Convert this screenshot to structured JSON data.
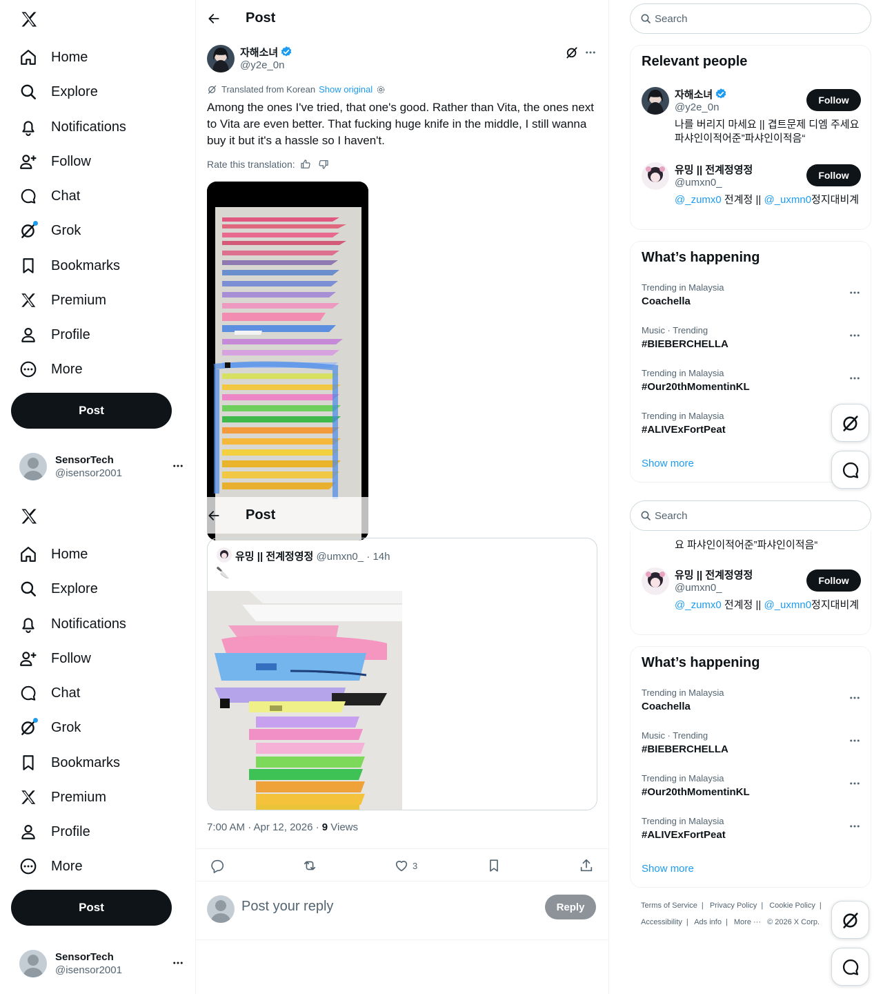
{
  "nav": {
    "items": [
      {
        "label": "Home",
        "icon": "home-icon"
      },
      {
        "label": "Explore",
        "icon": "search-icon"
      },
      {
        "label": "Notifications",
        "icon": "bell-icon"
      },
      {
        "label": "Follow",
        "icon": "person-add-icon"
      },
      {
        "label": "Chat",
        "icon": "chat-icon"
      },
      {
        "label": "Grok",
        "icon": "grok-icon"
      },
      {
        "label": "Bookmarks",
        "icon": "bookmark-icon"
      },
      {
        "label": "Premium",
        "icon": "x-logo-icon"
      },
      {
        "label": "Profile",
        "icon": "profile-icon"
      },
      {
        "label": "More",
        "icon": "more-circle-icon"
      }
    ],
    "post_label": "Post",
    "account": {
      "name": "SensorTech",
      "handle": "@isensor2001"
    }
  },
  "header": {
    "title": "Post"
  },
  "tweet": {
    "author_name": "자해소녀",
    "author_handle": "@y2e_0n",
    "translated_label": "Translated from Korean",
    "show_original": "Show original",
    "text": "Among the ones I've tried, that one's good. Rather than Vita, the ones next to Vita are even better. That fucking huge knife in the middle, I still wanna buy it but it's a hassle so I haven't.",
    "rate_label": "Rate this translation:",
    "quote": {
      "author_name": "유밍 || 전계정영정",
      "author_handle": "@umxn0_",
      "time": "· 14h",
      "text": "🔪"
    },
    "timestamp": "7:00 AM · Apr 12, 2026 · ",
    "views_count": "9",
    "views_label": " Views",
    "like_count": "3",
    "reply_placeholder": "Post your reply",
    "reply_button": "Reply"
  },
  "right": {
    "search_placeholder": "Search",
    "relevant_title": "Relevant people",
    "people": [
      {
        "name": "자해소녀",
        "handle": "@y2e_0n",
        "bio": "나를 버리지 마세요 || 겹트문제 디엠 주세요 파샤인이적어준”파샤인이적음“",
        "follow": "Follow"
      },
      {
        "name": "유밍 || 전계정영정",
        "handle": "@umxn0_",
        "bio_link1": "@_zumx0",
        "bio_mid": " 전계정 || ",
        "bio_link2": "@_uxmn0",
        "bio_end": "정지대비계",
        "follow": "Follow"
      }
    ],
    "happening_title": "What’s happening",
    "trends": [
      {
        "context": "Trending in Malaysia",
        "name": "Coachella"
      },
      {
        "context": "Music · Trending",
        "name": "#BIEBERCHELLA"
      },
      {
        "context": "Trending in Malaysia",
        "name": "#Our20thMomentinKL"
      },
      {
        "context": "Trending in Malaysia",
        "name": "#ALIVExFortPeat"
      }
    ],
    "show_more": "Show more",
    "partial_bio_line": "요 파샤인이적어준”파샤인이적음“",
    "footer": {
      "line1": [
        "Terms of Service",
        "|",
        "Privacy Policy",
        "|",
        "Cookie Policy",
        "|"
      ],
      "line2": [
        "Accessibility",
        "|",
        "Ads info",
        "|",
        "More ···",
        "© 2026 X Corp."
      ]
    }
  },
  "colors": {
    "accent": "#1d9bf0",
    "text": "#0f1419",
    "muted": "#536471",
    "border": "#cfd9de",
    "button_dark": "#0f1419"
  }
}
